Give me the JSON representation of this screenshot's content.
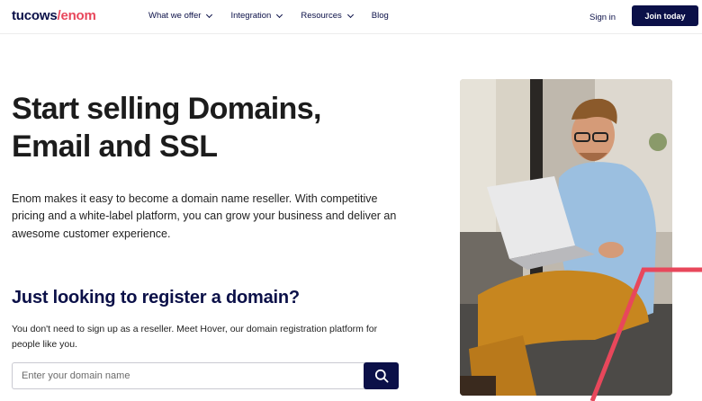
{
  "header": {
    "logo_part1": "tucows",
    "logo_part2": "/enom",
    "nav": [
      {
        "label": "What we offer"
      },
      {
        "label": "Integration"
      },
      {
        "label": "Resources"
      },
      {
        "label": "Blog"
      }
    ],
    "signin_label": "Sign in",
    "join_label": "Join today"
  },
  "hero": {
    "headline": "Start selling Domains, Email and SSL",
    "intro": "Enom makes it easy to become a domain name reseller. With competitive pricing and a white-label platform, you can grow your business and deliver an awesome customer experience."
  },
  "register": {
    "heading": "Just looking to register a domain?",
    "text": "You don't need to sign up as a reseller. Meet Hover, our domain registration platform for people like you.",
    "placeholder": "Enter your domain name"
  },
  "colors": {
    "brand_navy": "#0b1048",
    "brand_coral": "#e8475b"
  },
  "icons": {
    "search": "search-icon",
    "chevron": "chevron-down-icon"
  }
}
